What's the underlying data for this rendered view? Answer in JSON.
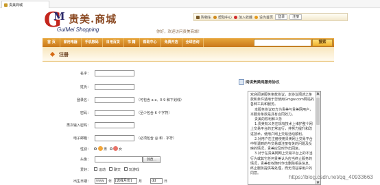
{
  "browser": {
    "tab_title": "贵美商城"
  },
  "logo": {
    "g": "G",
    "m": "M",
    "cn": "贵美.商城",
    "en": "GuiMei Shopping"
  },
  "slogan": "你好，欢迎访问贵美商城！",
  "toplinks": [
    {
      "label": "购物车",
      "icon": "cart-icon",
      "color": "#7a5a2a"
    },
    {
      "label": "帮助中心",
      "icon": "help-icon",
      "color": "#d08a1a"
    },
    {
      "label": "加入收藏",
      "icon": "heart-icon",
      "color": "#d12a2a"
    },
    {
      "label": "设为首页",
      "icon": "home-icon",
      "color": "#e59a1a"
    }
  ],
  "auth": {
    "login": "登录",
    "register": "注册"
  },
  "nav": [
    "首 页",
    "家用电器",
    "手机数码",
    "日用百货",
    "书 籍",
    "帮助中心",
    "免费开店",
    "全球咨询"
  ],
  "search": {
    "button": "搜索",
    "placeholder": ""
  },
  "banner": {
    "title": "注册"
  },
  "form": {
    "username_label": "名字：",
    "last_name_label": "姓氏：",
    "login_name_label": "登录名：",
    "login_name_hint": "（可包含 a-z、0-9 和下划线）",
    "password_label": "密码：",
    "password_hint": "（至少包含 6 个字符）",
    "confirm_password_label": "再次输入密码：",
    "email_label": "电子邮箱：",
    "email_hint": "（必须包含 @ 和 . 字符）",
    "gender_label": "性别：",
    "gender_male": "男",
    "gender_female": "女",
    "avatar_label": "头像：",
    "browse_button": "浏览...",
    "hobby_label": "爱好：",
    "hobbies": [
      "运动",
      "聊天",
      "玩游戏"
    ],
    "birthday_label": "出生日期：",
    "year_value": "yyyy",
    "year_unit": "年",
    "month_value": "[选择月份]",
    "month_unit": "月",
    "day_value": "dd",
    "day_unit": "日"
  },
  "agreement": {
    "title": "阅读贵美网服务协议",
    "paragraphs": [
      "欢迎阅读服务条款协议，本协议阐述之条款和条件适用于您使用Gmgw.com网站的各种工具和服务。",
      "本服务协议双方为贵美与贵美网用户，本服务条款是具有合同效力。",
      "贵美的权利和义务",
      "1.贵美有义务在现有技术上维护整个网上交易平台的正常运行，并努力提升和改进技术，使用户网上交易活动顺利。",
      "2.对用户在注册使用贵美网上交易平台中所遇到的与交易或注册有关的问题及反映的情况，贵美应及时作出回复。",
      "3.对于在贵美网网上交易平台上的不当行为或其它任何贵美认为应当终止服务的情况，贵美有权随时作出删除相关信息、终止服务提供等处理，而无须征得用户的同意。"
    ]
  },
  "watermark": "https://blog.csdn.net/qq_40933663"
}
